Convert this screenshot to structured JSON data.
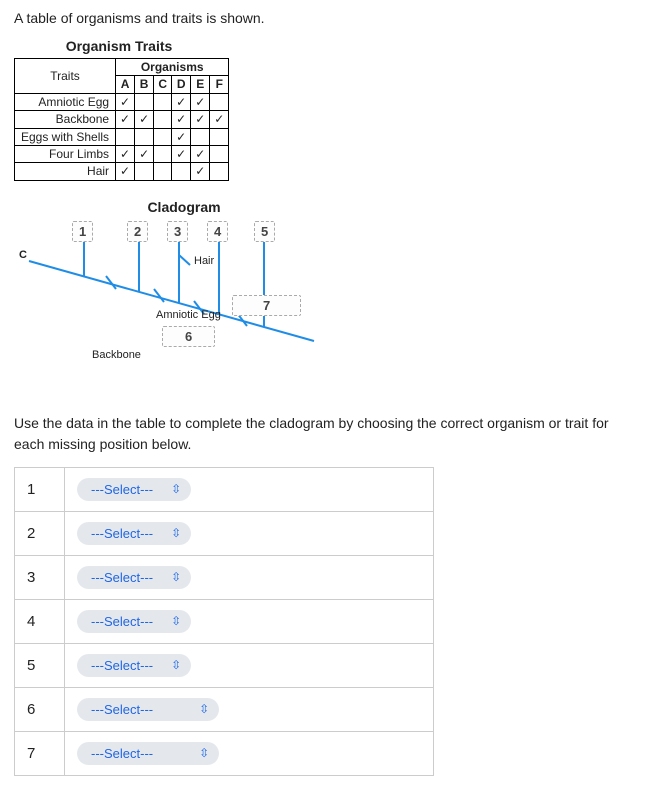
{
  "intro": "A table of organisms and traits is shown.",
  "traitsTable": {
    "title": "Organism Traits",
    "header": {
      "traits": "Traits",
      "organisms": "Organisms"
    },
    "orgLabels": [
      "A",
      "B",
      "C",
      "D",
      "E",
      "F"
    ],
    "rows": [
      {
        "label": "Amniotic Egg",
        "vals": [
          "✓",
          "",
          "",
          "✓",
          "✓",
          ""
        ]
      },
      {
        "label": "Backbone",
        "vals": [
          "✓",
          "✓",
          "",
          "✓",
          "✓",
          "✓"
        ]
      },
      {
        "label": "Eggs with Shells",
        "vals": [
          "",
          "",
          "",
          "✓",
          "",
          ""
        ]
      },
      {
        "label": "Four Limbs",
        "vals": [
          "✓",
          "✓",
          "",
          "✓",
          "✓",
          ""
        ]
      },
      {
        "label": "Hair",
        "vals": [
          "✓",
          "",
          "",
          "",
          "✓",
          ""
        ]
      }
    ]
  },
  "cladogram": {
    "title": "Cladogram",
    "rootLabel": "C",
    "boxes": {
      "b1": "1",
      "b2": "2",
      "b3": "3",
      "b4": "4",
      "b5": "5",
      "b6": "6",
      "b7": "7"
    },
    "labels": {
      "hair": "Hair",
      "amnioticEgg": "Amniotic Egg",
      "backbone": "Backbone"
    }
  },
  "instructions": "Use the data in the table to complete the cladogram by choosing the correct organism or trait for each missing position below.",
  "answers": {
    "placeholderShort": "---Select---",
    "placeholderLong": "---Select---",
    "rows": [
      {
        "num": "1",
        "wide": false
      },
      {
        "num": "2",
        "wide": false
      },
      {
        "num": "3",
        "wide": false
      },
      {
        "num": "4",
        "wide": false
      },
      {
        "num": "5",
        "wide": false
      },
      {
        "num": "6",
        "wide": true
      },
      {
        "num": "7",
        "wide": true
      }
    ]
  }
}
